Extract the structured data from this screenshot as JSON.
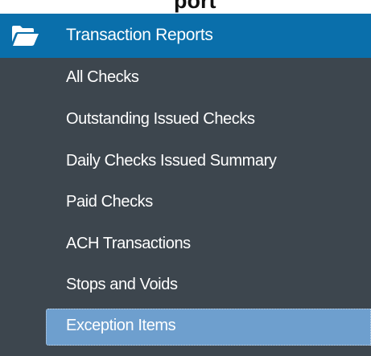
{
  "top_fragment": "port",
  "menu": {
    "header": {
      "label": "Transaction Reports",
      "icon": "folder-open-icon"
    },
    "items": [
      {
        "label": "All Checks",
        "selected": false
      },
      {
        "label": "Outstanding Issued Checks",
        "selected": false
      },
      {
        "label": "Daily Checks Issued Summary",
        "selected": false
      },
      {
        "label": "Paid Checks",
        "selected": false
      },
      {
        "label": "ACH Transactions",
        "selected": false
      },
      {
        "label": "Stops and Voids",
        "selected": false
      },
      {
        "label": "Exception Items",
        "selected": true
      }
    ]
  },
  "colors": {
    "header_bg": "#0a6fab",
    "menu_bg": "#3d464e",
    "selected_bg": "#6e9fce",
    "text": "#ffffff"
  }
}
